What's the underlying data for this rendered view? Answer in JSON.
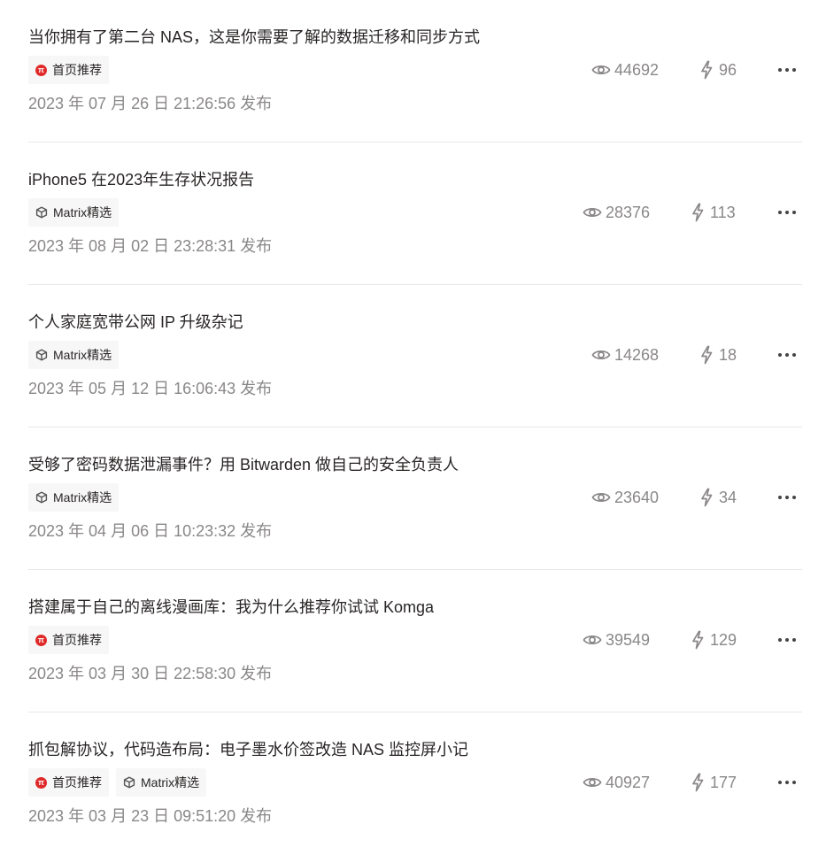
{
  "articles": [
    {
      "title": "当你拥有了第二台 NAS，这是你需要了解的数据迁移和同步方式",
      "tags": [
        {
          "type": "home",
          "label": "首页推荐"
        }
      ],
      "views": "44692",
      "charges": "96",
      "date": "2023 年 07 月 26 日 21:26:56 发布"
    },
    {
      "title": "iPhone5 在2023年生存状况报告",
      "tags": [
        {
          "type": "matrix",
          "label": "Matrix精选"
        }
      ],
      "views": "28376",
      "charges": "113",
      "date": "2023 年 08 月 02 日 23:28:31 发布"
    },
    {
      "title": "个人家庭宽带公网 IP 升级杂记",
      "tags": [
        {
          "type": "matrix",
          "label": "Matrix精选"
        }
      ],
      "views": "14268",
      "charges": "18",
      "date": "2023 年 05 月 12 日 16:06:43 发布"
    },
    {
      "title": "受够了密码数据泄漏事件？用 Bitwarden 做自己的安全负责人",
      "tags": [
        {
          "type": "matrix",
          "label": "Matrix精选"
        }
      ],
      "views": "23640",
      "charges": "34",
      "date": "2023 年 04 月 06 日 10:23:32 发布"
    },
    {
      "title": "搭建属于自己的离线漫画库：我为什么推荐你试试 Komga",
      "tags": [
        {
          "type": "home",
          "label": "首页推荐"
        }
      ],
      "views": "39549",
      "charges": "129",
      "date": "2023 年 03 月 30 日 22:58:30 发布"
    },
    {
      "title": "抓包解协议，代码造布局：电子墨水价签改造 NAS 监控屏小记",
      "tags": [
        {
          "type": "home",
          "label": "首页推荐"
        },
        {
          "type": "matrix",
          "label": "Matrix精选"
        }
      ],
      "views": "40927",
      "charges": "177",
      "date": "2023 年 03 月 23 日 09:51:20 发布"
    }
  ],
  "icons": {
    "views": "eye-icon",
    "charges": "lightning-icon",
    "more": "more-dots-icon",
    "home_tag": "pi-badge-icon",
    "matrix_tag": "cube-icon"
  },
  "colors": {
    "text": "#292525",
    "muted": "#8a8787",
    "tag_bg": "#f7f7f7",
    "home_badge": "#e02a2a",
    "divider": "#e8e8e8"
  }
}
